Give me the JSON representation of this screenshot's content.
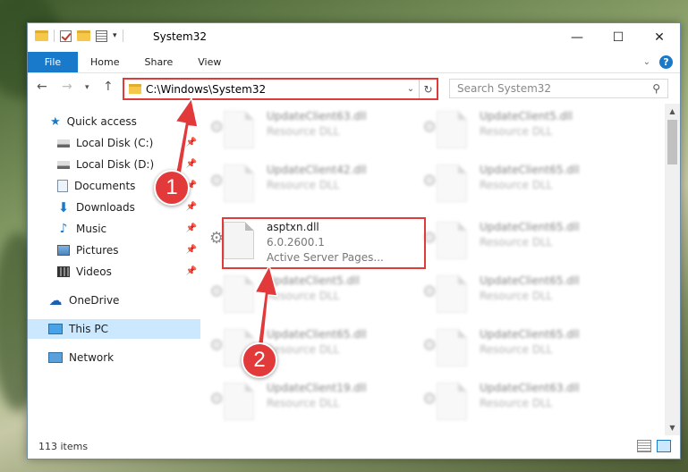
{
  "window": {
    "title": "System32",
    "minimize_glyph": "—",
    "maximize_glyph": "☐",
    "close_glyph": "✕"
  },
  "ribbon": {
    "tabs": [
      "File",
      "Home",
      "Share",
      "View"
    ],
    "help": "?"
  },
  "address": {
    "path": "C:\\Windows\\System32",
    "search_placeholder": "Search System32"
  },
  "nav": {
    "items": [
      {
        "label": "Quick access",
        "icon": "star-icon",
        "pinned": false
      },
      {
        "label": "Local Disk (C:)",
        "icon": "drive-icon",
        "pinned": true
      },
      {
        "label": "Local Disk (D:)",
        "icon": "drive-icon",
        "pinned": true
      },
      {
        "label": "Documents",
        "icon": "documents-icon",
        "pinned": true
      },
      {
        "label": "Downloads",
        "icon": "download-icon",
        "pinned": true
      },
      {
        "label": "Music",
        "icon": "music-icon",
        "pinned": true
      },
      {
        "label": "Pictures",
        "icon": "pictures-icon",
        "pinned": true
      },
      {
        "label": "Videos",
        "icon": "videos-icon",
        "pinned": true
      },
      {
        "label": "OneDrive",
        "icon": "cloud-icon",
        "pinned": false
      },
      {
        "label": "This PC",
        "icon": "computer-icon",
        "pinned": false,
        "selected": true
      },
      {
        "label": "Network",
        "icon": "network-icon",
        "pinned": false
      }
    ]
  },
  "files": {
    "left_column": [
      {
        "name": "UpdateClient63.dll",
        "type": "Resource DLL"
      },
      {
        "name": "UpdateClient42.dll",
        "type": "Resource DLL"
      },
      {
        "name": "asptxn.dll",
        "version": "6.0.2600.1",
        "type": "Active Server Pages..."
      },
      {
        "name": "UpdateClient5.dll",
        "type": "Resource DLL"
      },
      {
        "name": "UpdateClient65.dll",
        "type": "Resource DLL"
      },
      {
        "name": "UpdateClient19.dll",
        "type": "Resource DLL"
      }
    ],
    "right_column": [
      {
        "name": "UpdateClient5.dll",
        "type": "Resource DLL"
      },
      {
        "name": "UpdateClient65.dll",
        "type": "Resource DLL"
      },
      {
        "name": "UpdateClient65.dll",
        "type": "Resource DLL"
      },
      {
        "name": "UpdateClient65.dll",
        "type": "Resource DLL"
      },
      {
        "name": "UpdateClient65.dll",
        "type": "Resource DLL"
      },
      {
        "name": "UpdateClient63.dll",
        "type": "Resource DLL"
      }
    ]
  },
  "status": {
    "item_count": "113 items"
  },
  "annotations": {
    "step1": "1",
    "step2": "2",
    "color": "#e23a3a"
  },
  "colors": {
    "accent": "#1979ca",
    "selected": "#cce8ff",
    "highlight": "#e03b3b"
  }
}
